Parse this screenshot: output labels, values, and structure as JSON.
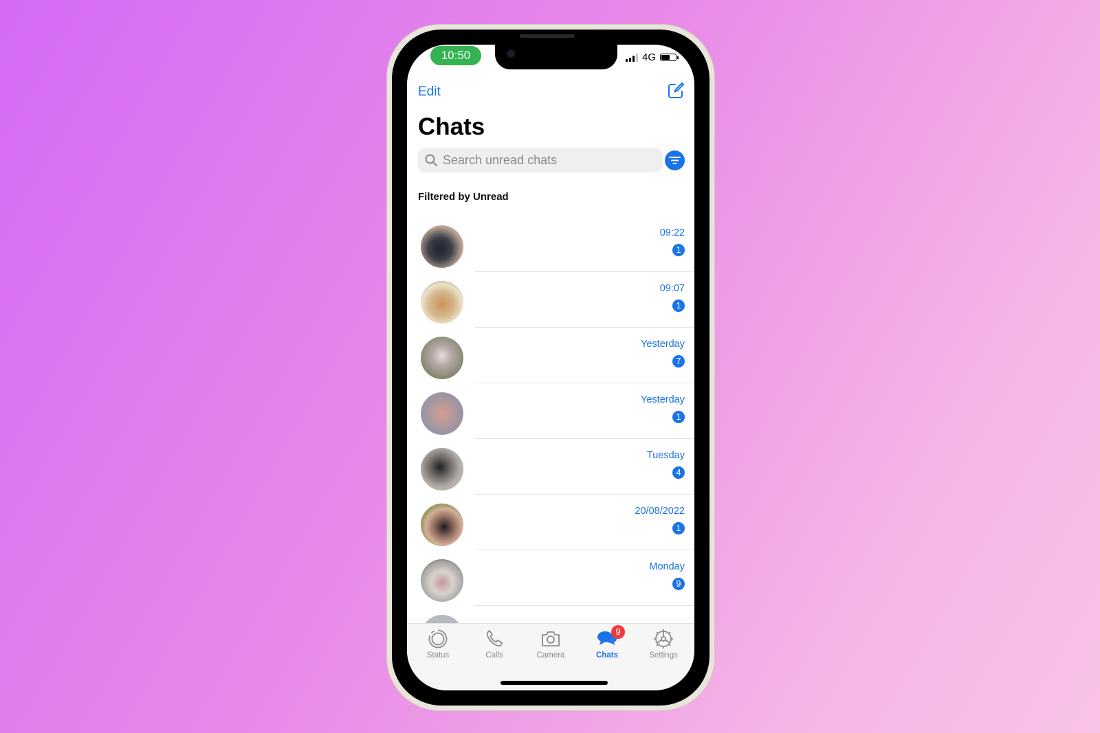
{
  "status_bar": {
    "time": "10:50",
    "network": "4G",
    "signal_bars_active": 3,
    "battery_level": 0.6
  },
  "header": {
    "edit_label": "Edit",
    "compose_icon": "compose-icon",
    "title": "Chats"
  },
  "search": {
    "placeholder": "Search unread chats",
    "value": ""
  },
  "filter": {
    "icon": "filter-icon",
    "label": "Filtered by Unread"
  },
  "chats": [
    {
      "name": "",
      "preview": "",
      "time": "09:22",
      "unread": "1"
    },
    {
      "name": "",
      "preview": "",
      "time": "09:07",
      "unread": "1"
    },
    {
      "name": "",
      "preview": "",
      "time": "Yesterday",
      "unread": "7"
    },
    {
      "name": "",
      "preview": "",
      "time": "Yesterday",
      "unread": "1"
    },
    {
      "name": "",
      "preview": "",
      "time": "Tuesday",
      "unread": "4"
    },
    {
      "name": "",
      "preview": "",
      "time": "20/08/2022",
      "unread": "1"
    },
    {
      "name": "",
      "preview": "",
      "time": "Monday",
      "unread": "9"
    }
  ],
  "tabs": [
    {
      "label": "Status",
      "icon": "status-icon",
      "active": false
    },
    {
      "label": "Calls",
      "icon": "phone-icon",
      "active": false
    },
    {
      "label": "Camera",
      "icon": "camera-icon",
      "active": false
    },
    {
      "label": "Chats",
      "icon": "chat-bubbles-icon",
      "active": true,
      "badge": "9"
    },
    {
      "label": "Settings",
      "icon": "gear-icon",
      "active": false
    }
  ],
  "colors": {
    "accent": "#1a73e8",
    "time_pill": "#34b450",
    "tab_badge": "#ee3b3b"
  }
}
